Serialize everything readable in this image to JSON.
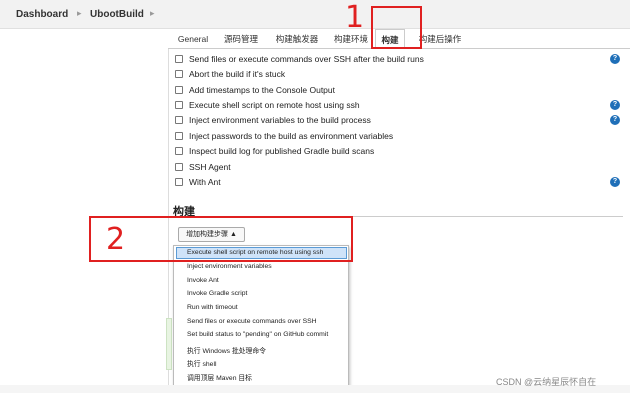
{
  "breadcrumb": {
    "items": [
      "Dashboard",
      "UbootBuild"
    ],
    "separator": "▸"
  },
  "tabs": [
    "General",
    "源码管理",
    "构建触发器",
    "构建环境",
    "构建",
    "构建后操作"
  ],
  "active_tab": "构建",
  "options": [
    {
      "label": "Send files or execute commands over SSH after the build runs",
      "help": true
    },
    {
      "label": "Abort the build if it's stuck",
      "help": false
    },
    {
      "label": "Add timestamps to the Console Output",
      "help": false
    },
    {
      "label": "Execute shell script on remote host using ssh",
      "help": true
    },
    {
      "label": "Inject environment variables to the build process",
      "help": true
    },
    {
      "label": "Inject passwords to the build as environment variables",
      "help": false
    },
    {
      "label": "Inspect build log for published Gradle build scans",
      "help": false
    },
    {
      "label": "SSH Agent",
      "help": false
    },
    {
      "label": "With Ant",
      "help": true
    }
  ],
  "help_glyph": "?",
  "build_section": {
    "title": "构建",
    "add_step_button": "增加构建步骤 ▲"
  },
  "dropdown": {
    "highlighted": "Execute shell script on remote host using ssh",
    "items": [
      "Execute shell script on remote host using ssh",
      "Inject environment variables",
      "Invoke Ant",
      "Invoke Gradle script",
      "Run with timeout",
      "Send files or execute commands over SSH",
      "Set build status to \"pending\" on GitHub commit",
      "执行 Windows 批处理命令",
      "执行 shell",
      "调用顶层 Maven 目标"
    ]
  },
  "annotations": [
    "1",
    "2"
  ],
  "watermark": "CSDN @云纳星辰怀自在",
  "colors": {
    "annotation_red": "#e02020",
    "help_blue": "#1f6fb8",
    "highlight": "#cfe3f9"
  }
}
